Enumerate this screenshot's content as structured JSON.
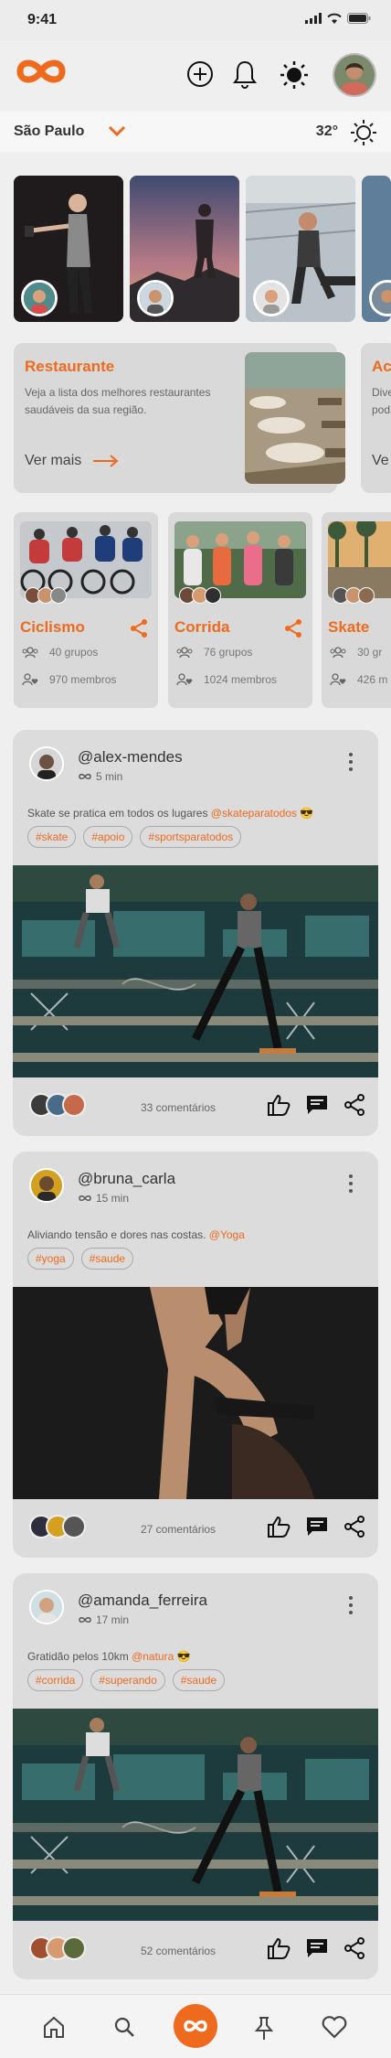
{
  "status": {
    "time": "9:41"
  },
  "location": {
    "city": "São Paulo",
    "temperature": "32°"
  },
  "promo_cards": [
    {
      "title": "Restaurante",
      "description": "Veja a lista dos melhores restaurantes saudáveis da sua região.",
      "link": "Ver mais"
    },
    {
      "title": "Ac",
      "description": "Dive pod",
      "link": "Ve"
    }
  ],
  "sports": [
    {
      "title": "Ciclismo",
      "groups": "40 grupos",
      "members": "970 membros"
    },
    {
      "title": "Corrida",
      "groups": "76 grupos",
      "members": "1024 membros"
    },
    {
      "title": "Skate",
      "groups": "30 gr",
      "members": "426 m"
    }
  ],
  "posts": [
    {
      "username": "@alex-mendes",
      "time": "5 min",
      "caption_text": "Skate se pratica em todos os lugares ",
      "caption_mention": "@skateparatodos",
      "emoji": "😎",
      "tags": [
        "#skate",
        "#apoio",
        "#sportsparatodos"
      ],
      "comments": "33 comentários"
    },
    {
      "username": "@bruna_carla",
      "time": "15 min",
      "caption_text": "Aliviando tensão e dores nas costas. ",
      "caption_mention": "@Yoga",
      "emoji": "",
      "tags": [
        "#yoga",
        "#saude"
      ],
      "comments": "27 comentários"
    },
    {
      "username": "@amanda_ferreira",
      "time": "17 min",
      "caption_text": "Gratidão pelos 10km ",
      "caption_mention": "@natura",
      "emoji": "😎",
      "tags": [
        "#corrida",
        "#superando",
        "#saude"
      ],
      "comments": "52 comentários"
    }
  ],
  "colors": {
    "accent": "#f06a1d",
    "card": "#d9d9d9",
    "background": "#efefef"
  },
  "icons": {
    "logo": "infinity-logo",
    "add": "plus-circle-icon",
    "notifications": "bell-icon",
    "theme": "sun-icon",
    "weather": "sun-outline-icon"
  },
  "bottom_nav": [
    "home-icon",
    "search-icon",
    "infinity-icon",
    "pin-icon",
    "heart-icon"
  ]
}
